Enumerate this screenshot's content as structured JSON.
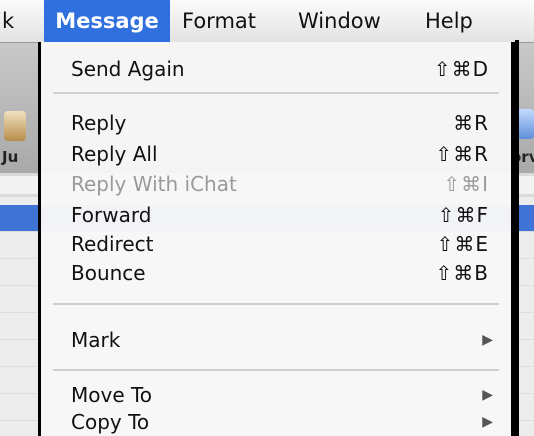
{
  "menubar": {
    "cut_label": "k",
    "items": [
      "Message",
      "Format",
      "Window",
      "Help"
    ]
  },
  "background": {
    "labels": [
      "Ju",
      "orv"
    ]
  },
  "menu": {
    "items": [
      {
        "label": "Send Again",
        "shortcut": "⇧⌘D",
        "enabled": true
      },
      {
        "label": "Reply",
        "shortcut": "⌘R",
        "enabled": true
      },
      {
        "label": "Reply All",
        "shortcut": "⇧⌘R",
        "enabled": true
      },
      {
        "label": "Reply With iChat",
        "shortcut": "⇧⌘I",
        "enabled": false
      },
      {
        "label": "Forward",
        "shortcut": "⇧⌘F",
        "enabled": true
      },
      {
        "label": "Redirect",
        "shortcut": "⇧⌘E",
        "enabled": true
      },
      {
        "label": "Bounce",
        "shortcut": "⇧⌘B",
        "enabled": true
      },
      {
        "label": "Mark",
        "submenu_arrow": "▶",
        "enabled": true
      },
      {
        "label": "Move To",
        "submenu_arrow": "▶",
        "enabled": true
      },
      {
        "label": "Copy To",
        "submenu_arrow": "▶",
        "enabled": true
      }
    ]
  },
  "colors": {
    "highlight": "#2f6fde",
    "disabled_text": "#9a9a9a"
  }
}
